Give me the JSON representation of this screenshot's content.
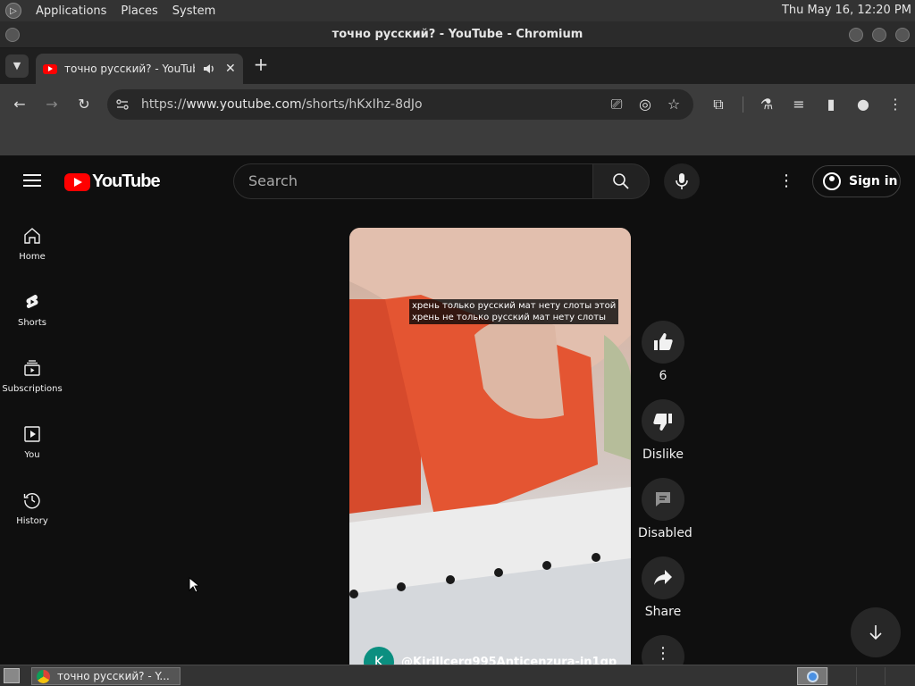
{
  "top_panel": {
    "menus": [
      "Applications",
      "Places",
      "System"
    ],
    "clock": "Thu May 16, 12:20 PM"
  },
  "window": {
    "title": "точно русский? - YouTube - Chromium"
  },
  "tabs": [
    {
      "title": "точно русский? - YouTube",
      "audio": "speaker-icon",
      "active": true
    }
  ],
  "toolbar": {
    "url_prefix": "https://",
    "url_host": "www.youtube.com",
    "url_path": "/shorts/hKxIhz-8dJo"
  },
  "youtube": {
    "logo_text": "YouTube",
    "search_placeholder": "Search",
    "sign_in_label": "Sign in",
    "guide": [
      {
        "label": "Home",
        "icon": "home-icon"
      },
      {
        "label": "Shorts",
        "icon": "shorts-icon"
      },
      {
        "label": "Subscriptions",
        "icon": "subscriptions-icon"
      },
      {
        "label": "You",
        "icon": "you-icon"
      },
      {
        "label": "History",
        "icon": "history-icon"
      }
    ],
    "short": {
      "subtitle_line1": "хрень только русский мат нету слоты этой",
      "subtitle_line2": "хрень не только русский мат нету слоты",
      "channel_initial": "K",
      "channel_handle": "@Kirillcerg995Anticenzura-in1qp"
    },
    "actions": {
      "like_count": "6",
      "dislike_label": "Dislike",
      "comments_label": "Disabled",
      "share_label": "Share"
    }
  },
  "taskbar": {
    "task_label": "точно русский? - Y..."
  },
  "colors": {
    "youtube_red": "#ff0000",
    "page_bg": "#0f0f0f",
    "button_bg": "#272727"
  }
}
